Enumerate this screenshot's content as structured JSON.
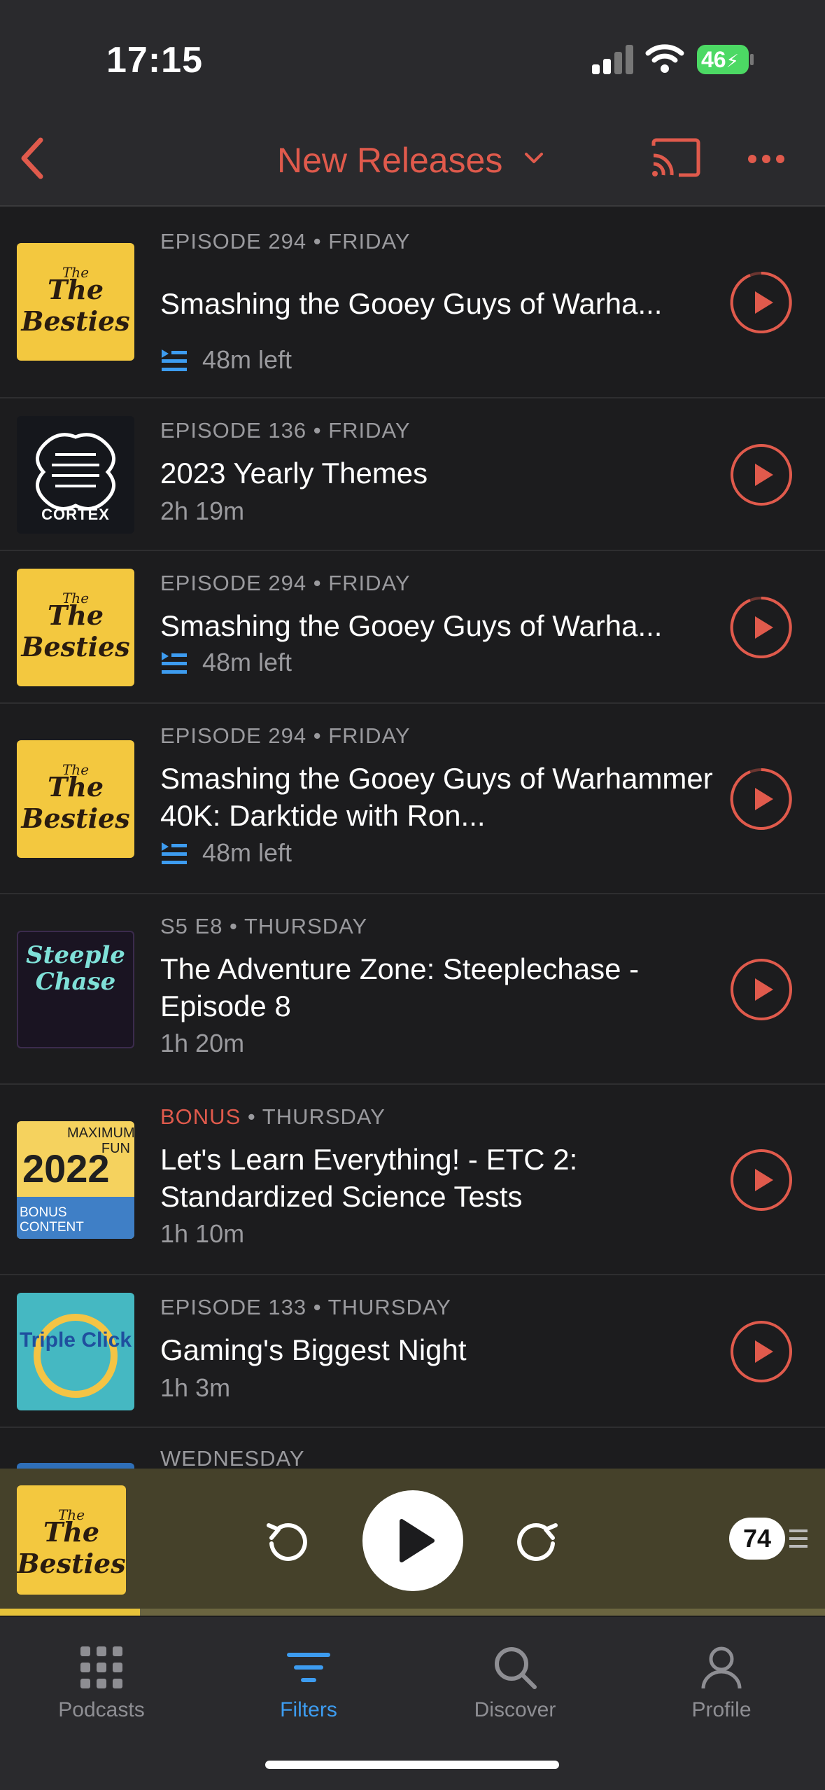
{
  "status_bar": {
    "time": "17:15",
    "battery": "46"
  },
  "nav": {
    "title": "New Releases"
  },
  "episodes": [
    {
      "meta": "EPISODE 294 • FRIDAY",
      "title": "Smashing the Gooey Guys of Warha...",
      "sub": "48m left",
      "art": "The Besties"
    },
    {
      "meta": "EPISODE 136 • FRIDAY",
      "title": "2023 Yearly Themes",
      "sub": "2h 19m",
      "art": "CORTEX"
    },
    {
      "meta": "EPISODE 294 • FRIDAY",
      "title": "Smashing the Gooey Guys of Warha...",
      "sub": "48m left",
      "art": "The Besties"
    },
    {
      "meta": "EPISODE 294 • FRIDAY",
      "title": "Smashing the Gooey Guys of Warhammer 40K: Darktide with Ron...",
      "sub": "48m left",
      "art": "The Besties"
    },
    {
      "meta": "S5 E8 • THURSDAY",
      "title": "The Adventure Zone: Steeplechase - Episode 8",
      "sub": "1h 20m",
      "art": "Steeple Chase"
    },
    {
      "meta_bonus": "BONUS",
      "meta": " • THURSDAY",
      "title": "Let's Learn Everything! - ETC 2: Standardized Science Tests",
      "sub": "1h 10m",
      "art_top": "MAXIMUM FUN",
      "art_bottom": "BONUS CONTENT",
      "art_year": "2022"
    },
    {
      "meta": "EPISODE 133 • THURSDAY",
      "title": "Gaming's Biggest Night",
      "sub": "1h 3m",
      "art": "Triple Click"
    },
    {
      "meta": "WEDNESDAY"
    }
  ],
  "mini_player": {
    "art": "The Besties",
    "up_next_count": "74",
    "progress": 0.17
  },
  "tabs": [
    {
      "label": "Podcasts",
      "icon": "grid-icon"
    },
    {
      "label": "Filters",
      "icon": "filters-icon",
      "active": true
    },
    {
      "label": "Discover",
      "icon": "search-icon"
    },
    {
      "label": "Profile",
      "icon": "person-icon"
    }
  ],
  "colors": {
    "accent": "#e05a4c",
    "tab_active": "#3d9cf0",
    "background": "#1c1c1e"
  }
}
